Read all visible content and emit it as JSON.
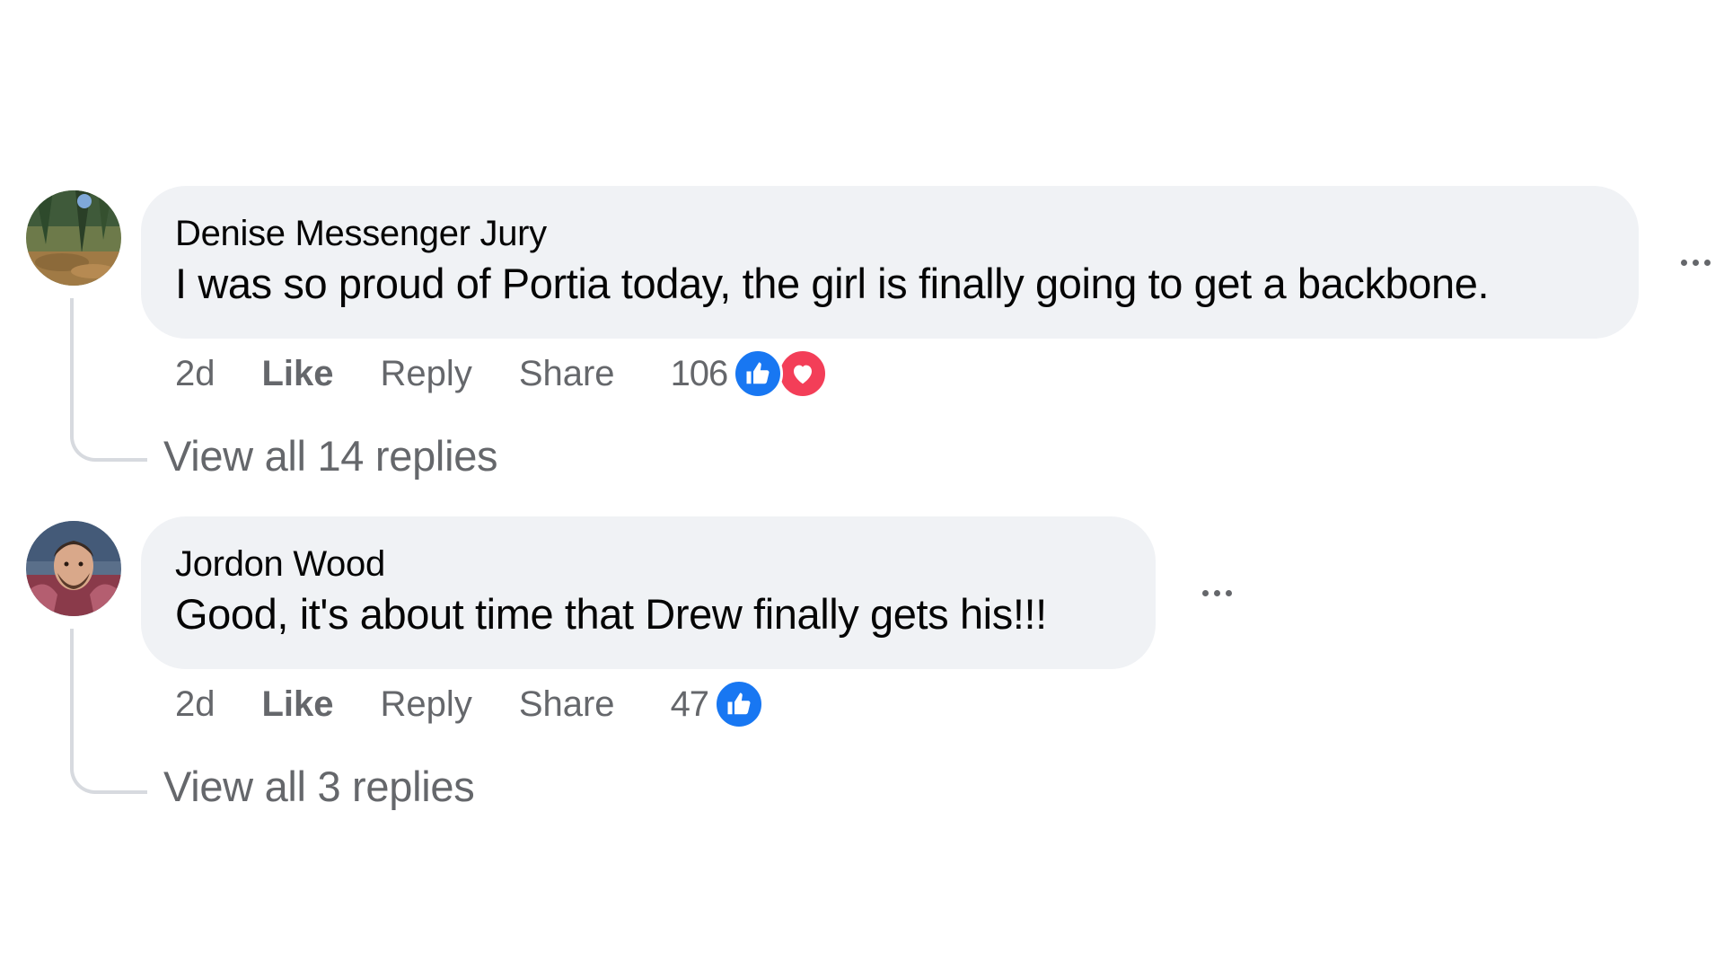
{
  "comments": [
    {
      "author": "Denise Messenger Jury",
      "text": "I was so proud of Portia today, the girl is finally going to get a backbone.",
      "time": "2d",
      "like_label": "Like",
      "reply_label": "Reply",
      "share_label": "Share",
      "reaction_count": "106",
      "reactions": [
        "like-icon",
        "love-icon"
      ],
      "view_replies": "View all 14 replies"
    },
    {
      "author": "Jordon Wood",
      "text": "Good, it's about time that Drew finally gets his!!!",
      "time": "2d",
      "like_label": "Like",
      "reply_label": "Reply",
      "share_label": "Share",
      "reaction_count": "47",
      "reactions": [
        "like-icon"
      ],
      "view_replies": "View all 3 replies"
    }
  ],
  "colors": {
    "bubble_bg": "#f0f2f5",
    "secondary_text": "#65676b",
    "like_blue": "#1877f2",
    "love_red": "#f33e58",
    "thread_line": "#d7dadf"
  }
}
